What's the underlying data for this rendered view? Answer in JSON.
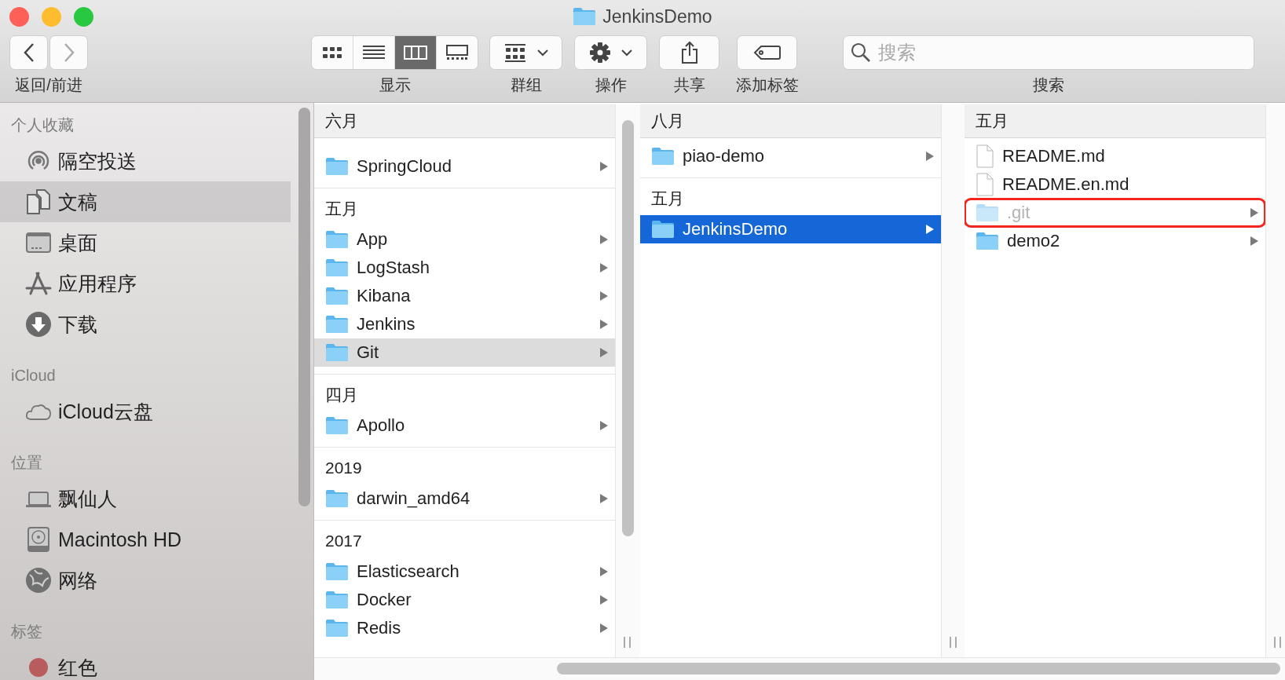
{
  "window": {
    "title": "JenkinsDemo"
  },
  "toolbar": {
    "nav": {
      "label": "返回/前进",
      "buttons": [
        {
          "kind": "back",
          "disabled": false
        },
        {
          "kind": "forward",
          "disabled": true
        }
      ]
    },
    "view": {
      "label": "显示",
      "modes": [
        {
          "kind": "icons",
          "selected": false
        },
        {
          "kind": "list",
          "selected": false
        },
        {
          "kind": "columns",
          "selected": true
        },
        {
          "kind": "gallery",
          "selected": false
        }
      ]
    },
    "tools": [
      {
        "kind": "group",
        "label": "群组"
      },
      {
        "kind": "action",
        "label": "操作"
      },
      {
        "kind": "share",
        "label": "共享"
      },
      {
        "kind": "tag",
        "label": "添加标签"
      }
    ],
    "search": {
      "placeholder": "搜索",
      "label": "搜索"
    }
  },
  "sidebar": {
    "sections": [
      {
        "title": "个人收藏",
        "items": [
          {
            "kind": "airdrop",
            "label": "隔空投送",
            "selected": false
          },
          {
            "kind": "documents",
            "label": "文稿",
            "selected": true
          },
          {
            "kind": "desktop",
            "label": "桌面",
            "selected": false
          },
          {
            "kind": "applications",
            "label": "应用程序",
            "selected": false
          },
          {
            "kind": "downloads",
            "label": "下载",
            "selected": false
          }
        ]
      },
      {
        "title": "iCloud",
        "items": [
          {
            "kind": "icloud",
            "label": "iCloud云盘",
            "selected": false
          }
        ]
      },
      {
        "title": "位置",
        "items": [
          {
            "kind": "laptop",
            "label": "飘仙人",
            "selected": false
          },
          {
            "kind": "disk",
            "label": "Macintosh HD",
            "selected": false
          },
          {
            "kind": "network",
            "label": "网络",
            "selected": false
          }
        ]
      },
      {
        "title": "标签",
        "items": [
          {
            "kind": "tag",
            "label": "红色",
            "color": "#b85c5e",
            "selected": false
          }
        ]
      }
    ]
  },
  "columns": [
    {
      "header": "六月",
      "sections": [
        {
          "items": [
            {
              "kind": "folder",
              "name": "SpringCloud",
              "selected": false,
              "dimmed": false,
              "annotated": false
            }
          ]
        },
        {
          "title": "五月",
          "items": [
            {
              "kind": "folder",
              "name": "App",
              "selected": false,
              "dimmed": false,
              "annotated": false
            },
            {
              "kind": "folder",
              "name": "LogStash",
              "selected": false,
              "dimmed": false,
              "annotated": false
            },
            {
              "kind": "folder",
              "name": "Kibana",
              "selected": false,
              "dimmed": false,
              "annotated": false
            },
            {
              "kind": "folder",
              "name": "Jenkins",
              "selected": false,
              "dimmed": false,
              "annotated": false
            },
            {
              "kind": "folder",
              "name": "Git",
              "selected": true,
              "dimmed": false,
              "annotated": false
            }
          ]
        },
        {
          "title": "四月",
          "items": [
            {
              "kind": "folder",
              "name": "Apollo",
              "selected": false,
              "dimmed": false,
              "annotated": false
            }
          ]
        },
        {
          "title": "2019",
          "items": [
            {
              "kind": "folder",
              "name": "darwin_amd64",
              "selected": false,
              "dimmed": false,
              "annotated": false
            }
          ]
        },
        {
          "title": "2017",
          "items": [
            {
              "kind": "folder",
              "name": "Elasticsearch",
              "selected": false,
              "dimmed": false,
              "annotated": false
            },
            {
              "kind": "folder",
              "name": "Docker",
              "selected": false,
              "dimmed": false,
              "annotated": false
            },
            {
              "kind": "folder",
              "name": "Redis",
              "selected": false,
              "dimmed": false,
              "annotated": false
            }
          ]
        }
      ]
    },
    {
      "header": "八月",
      "sections": [
        {
          "items": [
            {
              "kind": "folder",
              "name": "piao-demo",
              "selected": false,
              "dimmed": false,
              "annotated": false
            }
          ]
        },
        {
          "title": "五月",
          "items": [
            {
              "kind": "folder",
              "name": "JenkinsDemo",
              "selected": true,
              "dimmed": false,
              "annotated": false
            }
          ]
        }
      ]
    },
    {
      "header": "五月",
      "sections": [
        {
          "items": [
            {
              "kind": "file",
              "name": "README.md",
              "selected": false,
              "dimmed": false,
              "annotated": false
            },
            {
              "kind": "file",
              "name": "README.en.md",
              "selected": false,
              "dimmed": false,
              "annotated": false
            },
            {
              "kind": "folder",
              "name": ".git",
              "selected": false,
              "dimmed": true,
              "annotated": true
            },
            {
              "kind": "folder",
              "name": "demo2",
              "selected": false,
              "dimmed": false,
              "annotated": false
            }
          ]
        }
      ]
    }
  ]
}
